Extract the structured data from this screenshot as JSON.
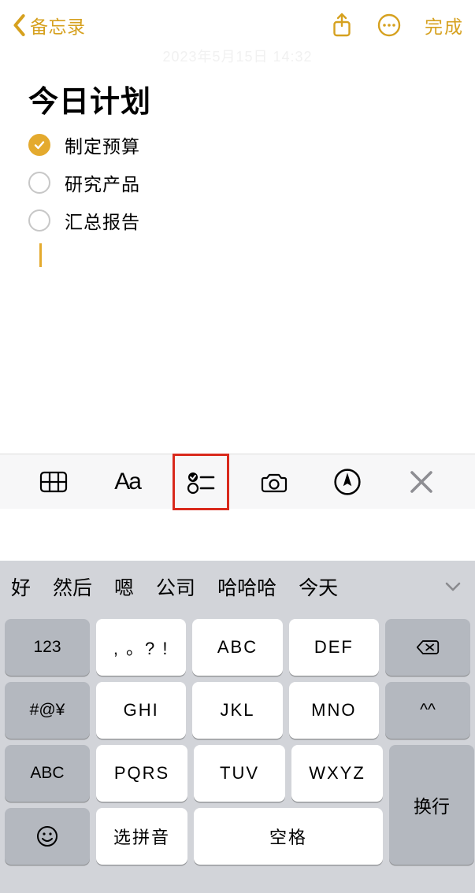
{
  "nav": {
    "back_label": "备忘录",
    "done_label": "完成"
  },
  "note": {
    "timestamp_ghost": "2023年5月15日 14:32",
    "title": "今日计划",
    "items": [
      {
        "text": "制定预算",
        "done": true
      },
      {
        "text": "研究产品",
        "done": false
      },
      {
        "text": "汇总报告",
        "done": false
      }
    ]
  },
  "format_bar": {
    "aa_label": "Aa"
  },
  "suggestions": [
    "好",
    "然后",
    "嗯",
    "公司",
    "哈哈哈",
    "今天"
  ],
  "keyboard": {
    "num_key": "123",
    "punct_key": ", 。? !",
    "abc_key": "ABC",
    "def_key": "DEF",
    "sym_key": "#@¥",
    "ghi_key": "GHI",
    "jkl_key": "JKL",
    "mno_key": "MNO",
    "face_key": "^^",
    "abc_shift": "ABC",
    "pqrs_key": "PQRS",
    "tuv_key": "TUV",
    "wxyz_key": "WXYZ",
    "pinyin_key": "选拼音",
    "space_key": "空格",
    "enter_key": "换行"
  },
  "colors": {
    "accent": "#e4aa2e",
    "highlight_box": "#d9291c"
  }
}
